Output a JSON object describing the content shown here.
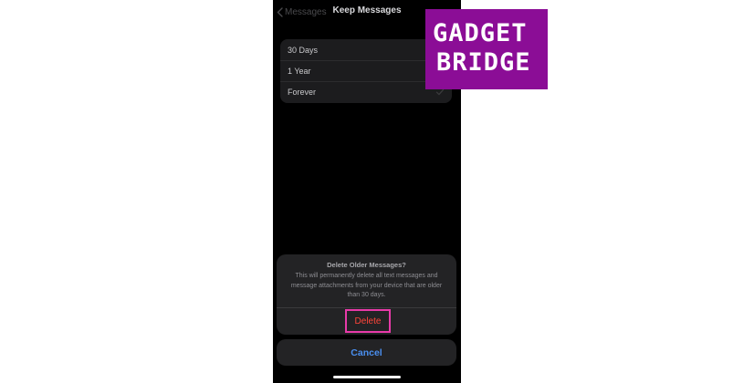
{
  "navbar": {
    "back_label": "Messages",
    "title": "Keep Messages"
  },
  "options": [
    {
      "label": "30 Days",
      "selected": false
    },
    {
      "label": "1 Year",
      "selected": false
    },
    {
      "label": "Forever",
      "selected": true
    }
  ],
  "sheet": {
    "title": "Delete Older Messages?",
    "message": "This will permanently delete all text messages and message attachments from your device that are older than 30 days.",
    "delete_label": "Delete",
    "cancel_label": "Cancel"
  },
  "logo": {
    "line1": "GADGET",
    "line2": "BRIDGE",
    "background": "#8b0d96"
  },
  "colors": {
    "destructive": "#ff453a",
    "accent": "#4a8ff0",
    "highlight_box": "#e83aa9"
  },
  "icons": [
    "chevron-left-icon",
    "checkmark-icon",
    "gadget-bridge-logo"
  ]
}
